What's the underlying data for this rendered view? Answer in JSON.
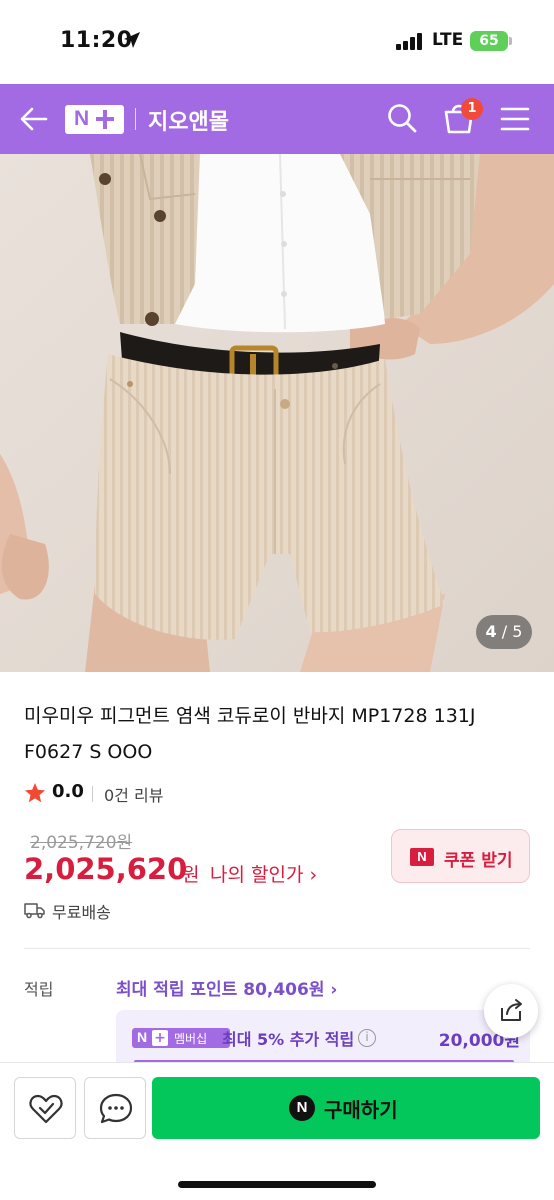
{
  "status_bar": {
    "time": "11:20",
    "network": "LTE",
    "battery": "65"
  },
  "header": {
    "store_name": "지오앤몰",
    "cart_count": "1"
  },
  "gallery": {
    "current": "4",
    "separator": "/",
    "total": "5"
  },
  "product": {
    "title": "미우미우 피그먼트 염색 코듀로이 반바지 MP1728 131J F0627 S OOO",
    "rating": "0.0",
    "review_count": "0건 리뷰",
    "original_price": "2,025,720원",
    "sale_price": "2,025,620",
    "sale_currency": "원",
    "my_discount_label": "나의 할인가 ›",
    "shipping": "무료배송"
  },
  "coupon": {
    "icon_text": "N",
    "label": "쿠폰 받기"
  },
  "points": {
    "label": "적립",
    "max_text": "최대 적립 포인트 80,406원 ›",
    "membership_badge_text": "멤버십",
    "membership_extra": "최대 5% 추가 적립",
    "membership_amount": "20,000원"
  },
  "bottom": {
    "buy_label": "구매하기",
    "buy_icon_text": "N"
  },
  "colors": {
    "brand_purple": "#a26be3",
    "sale_red": "#d71e3f",
    "buy_green": "#03c75a"
  }
}
